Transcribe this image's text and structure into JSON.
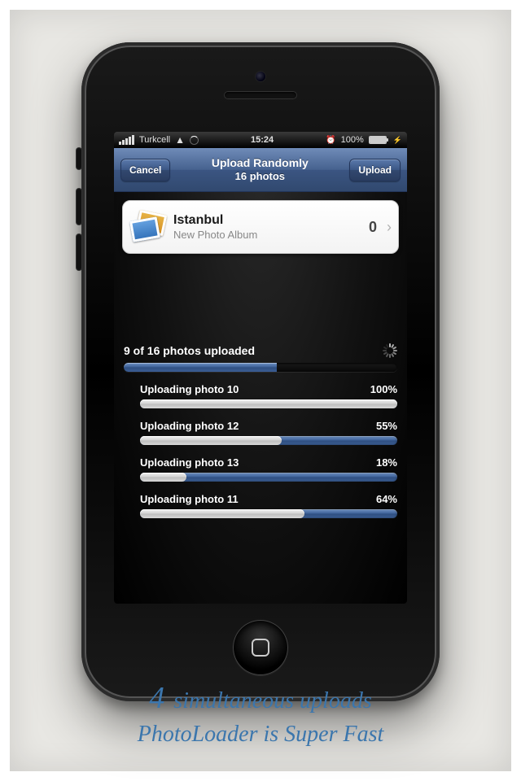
{
  "statusbar": {
    "carrier": "Turkcell",
    "time": "15:24",
    "battery_pct": "100%"
  },
  "navbar": {
    "cancel": "Cancel",
    "title_line1": "Upload Randomly",
    "title_line2": "16 photos",
    "upload": "Upload"
  },
  "album": {
    "name": "Istanbul",
    "subtitle": "New Photo Album",
    "count": "0"
  },
  "overall": {
    "label": "9 of 16 photos uploaded",
    "pct": 56
  },
  "uploads": [
    {
      "label": "Uploading photo 10",
      "pct_label": "100%",
      "pct": 100
    },
    {
      "label": "Uploading photo 12",
      "pct_label": "55%",
      "pct": 55
    },
    {
      "label": "Uploading photo 13",
      "pct_label": "18%",
      "pct": 18
    },
    {
      "label": "Uploading photo 11",
      "pct_label": "64%",
      "pct": 64
    }
  ],
  "caption": {
    "big": "4",
    "line1_rest": " simultaneous uploads",
    "line2": "PhotoLoader is Super Fast"
  }
}
